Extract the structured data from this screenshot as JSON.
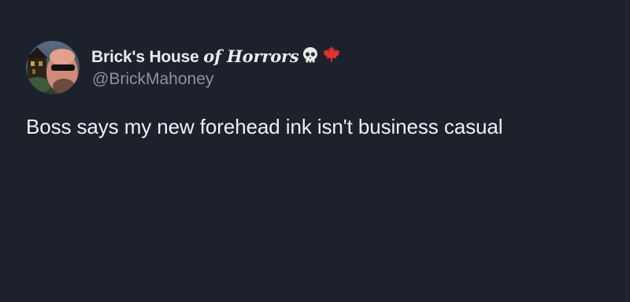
{
  "tweet": {
    "display_name_plain": "Brick's House ",
    "display_name_gothic": "of Horrors",
    "name_emojis": [
      "skull-icon",
      "maple-leaf-icon"
    ],
    "handle": "@BrickMahoney",
    "text": "Boss says my new forehead ink isn't business casual"
  },
  "colors": {
    "background": "#1c212b",
    "name": "#e8eaed",
    "handle": "#8b949e",
    "text": "#eef0f3",
    "maple_leaf": "#e0322e"
  }
}
